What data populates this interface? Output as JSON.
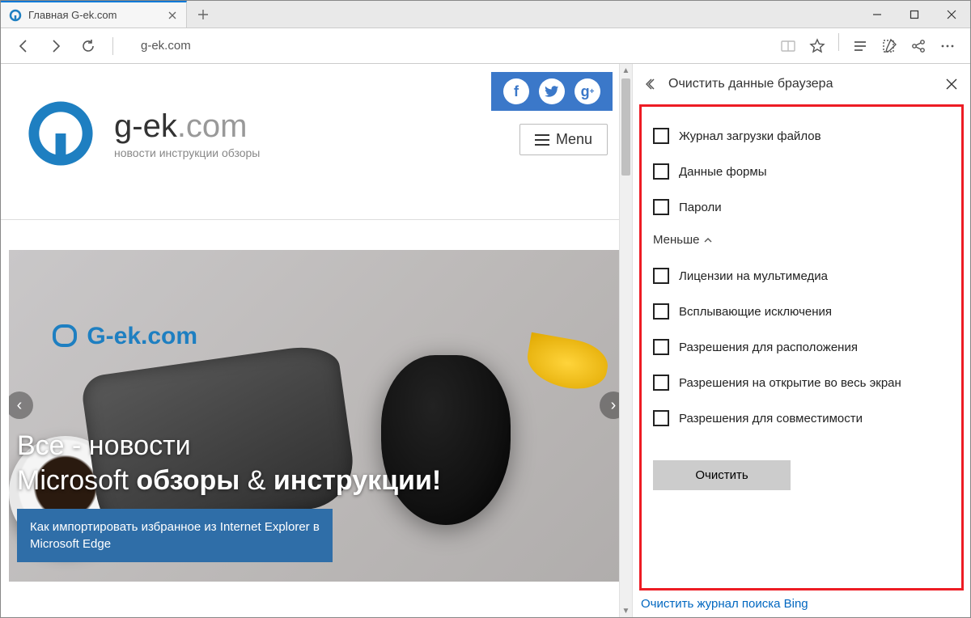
{
  "tab": {
    "title": "Главная G-ek.com"
  },
  "url": "g-ek.com",
  "site": {
    "title_main": "g-ek",
    "title_domain": ".com",
    "tagline": "новости инструкции обзоры",
    "menu_label": "Menu",
    "hero_brand": "G-ek.com",
    "hero_line1": "Все - новости",
    "hero_line2_a": "Microsoft ",
    "hero_line2_b": "обзоры",
    "hero_line2_c": " & ",
    "hero_line2_d": "инструкции!",
    "hero_sub_l1": "Как импортировать избранное из Internet Explorer в",
    "hero_sub_l2": "Microsoft Edge"
  },
  "panel": {
    "title": "Очистить данные браузера",
    "items": [
      "Журнал загрузки файлов",
      "Данные формы",
      "Пароли"
    ],
    "less": "Меньше",
    "items2": [
      "Лицензии на мультимедиа",
      "Всплывающие исключения",
      "Разрешения для расположения",
      "Разрешения на открытие во весь экран",
      "Разрешения для совместимости"
    ],
    "clear_btn": "Очистить",
    "link": "Очистить журнал поиска Bing"
  }
}
